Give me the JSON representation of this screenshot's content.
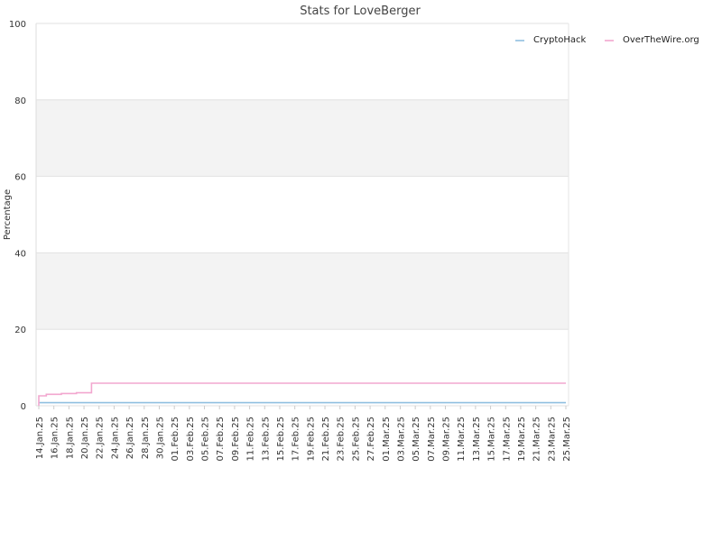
{
  "chart_data": {
    "type": "line",
    "title": "Stats for LoveBerger",
    "xlabel": "",
    "ylabel": "Percentage",
    "ylim": [
      0,
      100
    ],
    "yticks": [
      0,
      20,
      40,
      60,
      80,
      100
    ],
    "xlim": [
      "14.Jan.25",
      "25.Mar.25"
    ],
    "xticks": [
      "14.Jan.25",
      "16.Jan.25",
      "18.Jan.25",
      "20.Jan.25",
      "22.Jan.25",
      "24.Jan.25",
      "26.Jan.25",
      "28.Jan.25",
      "30.Jan.25",
      "01.Feb.25",
      "03.Feb.25",
      "05.Feb.25",
      "07.Feb.25",
      "09.Feb.25",
      "11.Feb.25",
      "13.Feb.25",
      "15.Feb.25",
      "17.Feb.25",
      "19.Feb.25",
      "21.Feb.25",
      "23.Feb.25",
      "25.Feb.25",
      "27.Feb.25",
      "01.Mar.25",
      "03.Mar.25",
      "05.Mar.25",
      "07.Mar.25",
      "09.Mar.25",
      "11.Mar.25",
      "13.Mar.25",
      "15.Mar.25",
      "17.Mar.25",
      "19.Mar.25",
      "21.Mar.25",
      "23.Mar.25",
      "25.Mar.25"
    ],
    "grid": true,
    "legend_position": "top-right",
    "series": [
      {
        "name": "CryptoHack",
        "color": "#8fbfe0",
        "step": true,
        "points": [
          [
            "14.Jan.25",
            0.8
          ],
          [
            "25.Mar.25",
            0.8
          ]
        ]
      },
      {
        "name": "OverTheWire.org",
        "color": "#f2a7cf",
        "step": true,
        "points": [
          [
            "14.Jan.25",
            0.0
          ],
          [
            "14.Jan.25",
            2.6
          ],
          [
            "15.Jan.25",
            3.0
          ],
          [
            "17.Jan.25",
            3.2
          ],
          [
            "19.Jan.25",
            3.4
          ],
          [
            "21.Jan.25",
            3.6
          ],
          [
            "21.Jan.25",
            5.9
          ],
          [
            "25.Mar.25",
            5.9
          ]
        ]
      }
    ]
  }
}
